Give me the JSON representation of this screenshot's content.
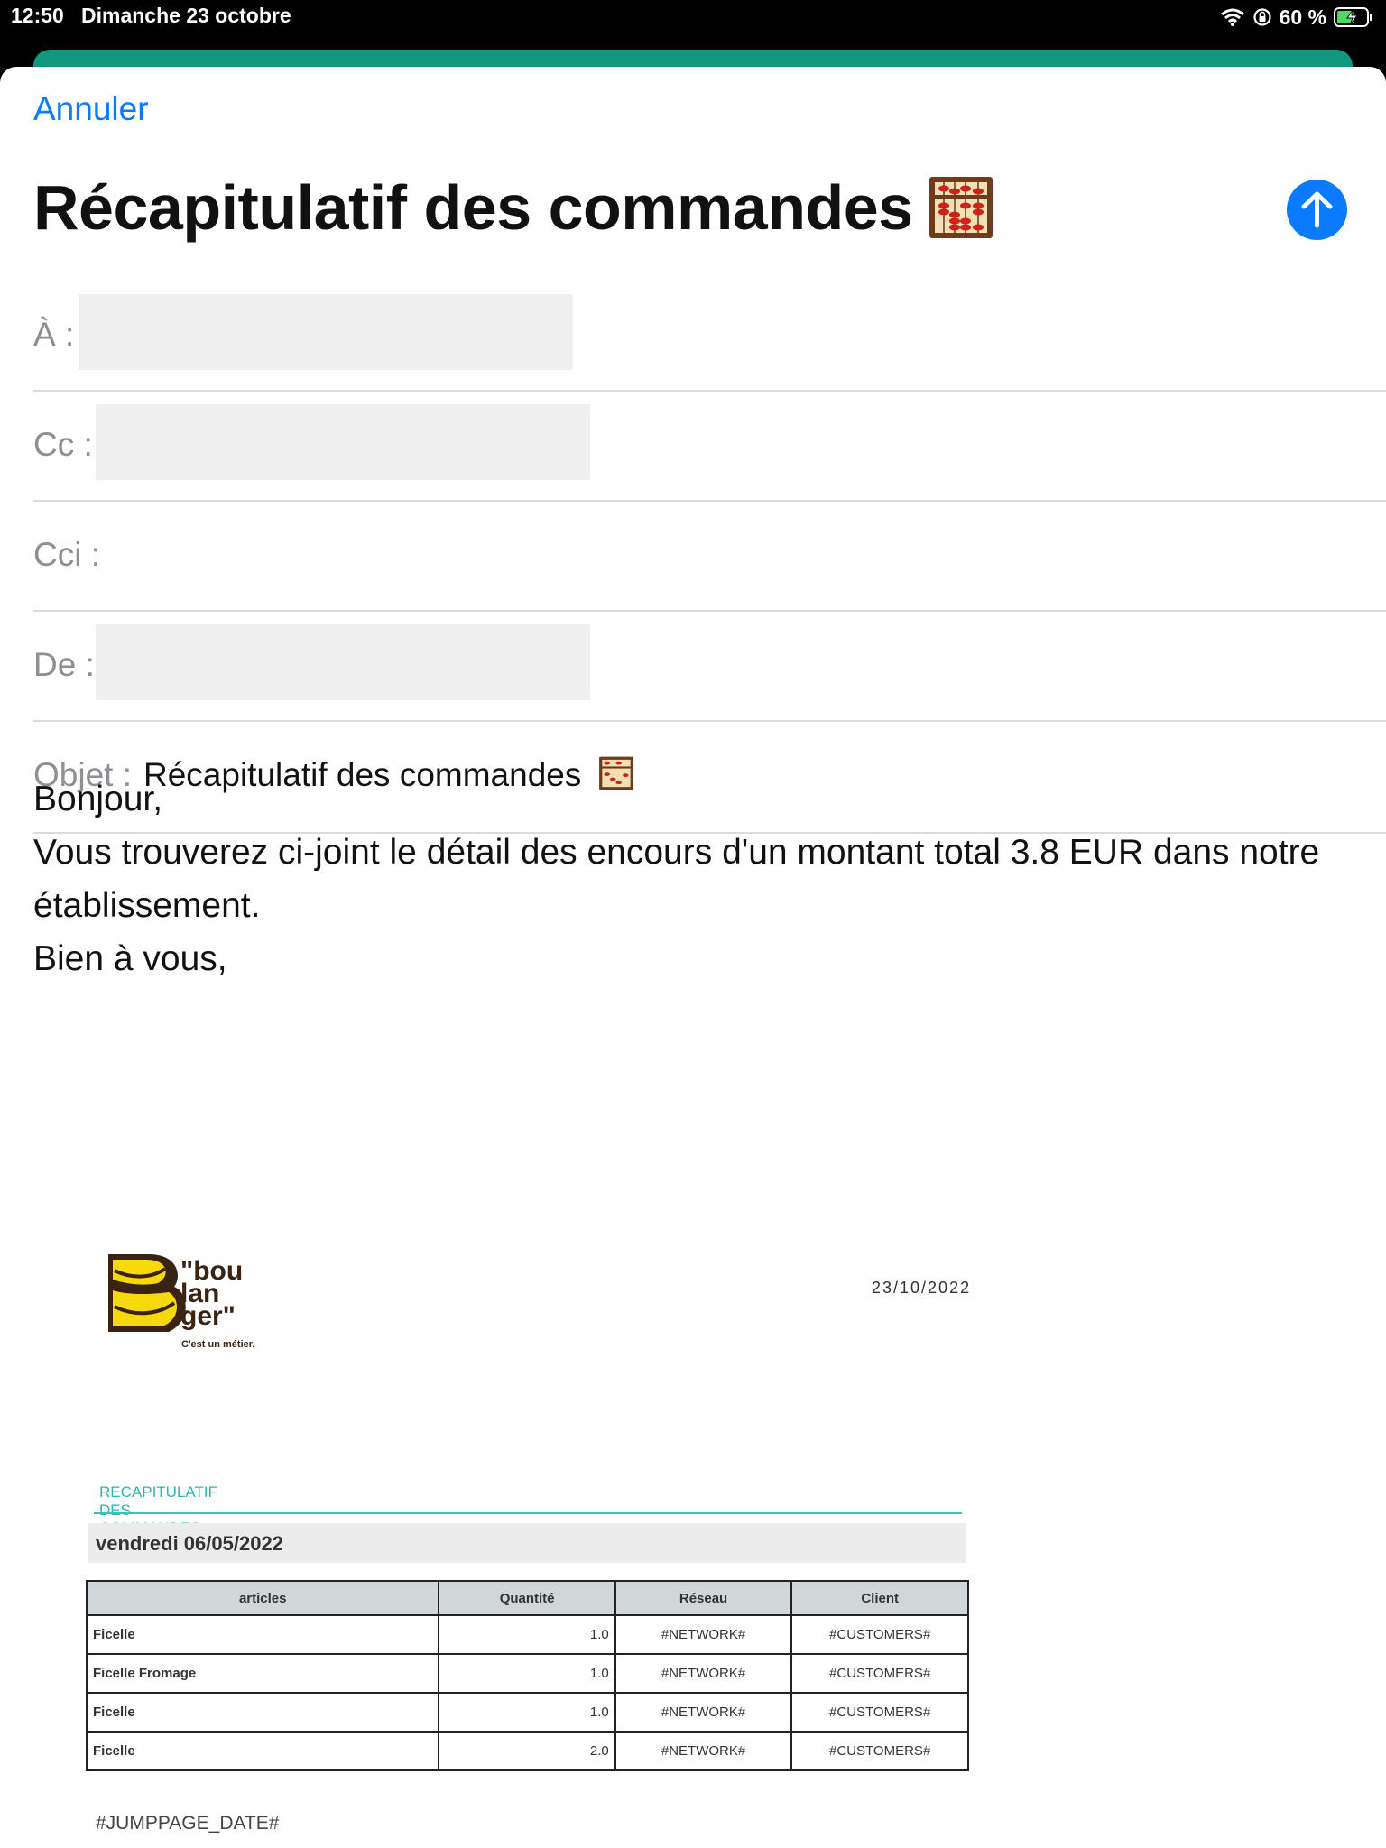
{
  "status_bar": {
    "time": "12:50",
    "date": "Dimanche 23 octobre",
    "battery": "60 %"
  },
  "compose": {
    "cancel": "Annuler",
    "title": "Récapitulatif des commandes",
    "title_emoji": "abacus-icon",
    "accent_color": "#0a7aff"
  },
  "fields": {
    "to_label": "À :",
    "cc_label": "Cc :",
    "bcc_label": "Cci :",
    "from_label": "De :",
    "subject_label": "Objet :",
    "subject_value": "Récapitulatif des commandes"
  },
  "body": {
    "line1": "Bonjour,",
    "line2": "Vous trouverez ci-joint le détail des encours d'un montant total 3.8 EUR dans notre établissement.",
    "line3": "Bien à vous,"
  },
  "document": {
    "logo_text": [
      "\"bou",
      "lan",
      "ger\""
    ],
    "logo_tagline": "C'est un métier.",
    "date": "23/10/2022",
    "section_title": "RECAPITULATIF DES COMMANDES",
    "day": "vendredi 06/05/2022",
    "headers": {
      "articles": "articles",
      "quantity": "Quantité",
      "network": "Réseau",
      "client": "Client"
    },
    "rows": [
      {
        "article": "Ficelle",
        "qty": "1.0",
        "network": "#NETWORK#",
        "client": "#CUSTOMERS#"
      },
      {
        "article": "Ficelle Fromage",
        "qty": "1.0",
        "network": "#NETWORK#",
        "client": "#CUSTOMERS#"
      },
      {
        "article": "Ficelle",
        "qty": "1.0",
        "network": "#NETWORK#",
        "client": "#CUSTOMERS#"
      },
      {
        "article": "Ficelle",
        "qty": "2.0",
        "network": "#NETWORK#",
        "client": "#CUSTOMERS#"
      }
    ],
    "footer": "#JUMPPAGE_DATE#"
  }
}
